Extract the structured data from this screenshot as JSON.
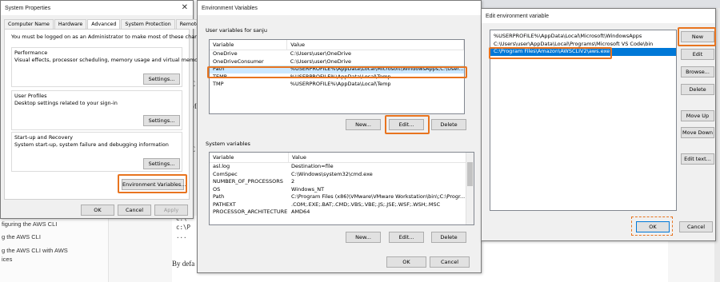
{
  "background_page": {
    "sidebar_links": [
      "figuring the AWS CLI",
      "g the AWS CLI",
      "g the AWS CLI with AWS",
      "ices"
    ],
    "code_lines": [
      "C:\\",
      "c:\\P",
      "..."
    ],
    "body_text": "By defa",
    "side_letters": [
      "C",
      "M",
      "t",
      "C"
    ]
  },
  "system_properties": {
    "title": "System Properties",
    "tabs": [
      "Computer Name",
      "Hardware",
      "Advanced",
      "System Protection",
      "Remote"
    ],
    "active_tab": "Advanced",
    "admin_note": "You must be logged on as an Administrator to make most of these changes.",
    "performance": {
      "title": "Performance",
      "desc": "Visual effects, processor scheduling, memory usage and virtual memory",
      "button": "Settings..."
    },
    "user_profiles": {
      "title": "User Profiles",
      "desc": "Desktop settings related to your sign-in",
      "button": "Settings..."
    },
    "startup": {
      "title": "Start-up and Recovery",
      "desc": "System start-up, system failure and debugging information",
      "button": "Settings..."
    },
    "env_button": "Environment Variables...",
    "ok": "OK",
    "cancel": "Cancel",
    "apply": "Apply"
  },
  "env_vars": {
    "title": "Environment Variables",
    "user_group_label": "User variables for sanju",
    "columns": [
      "Variable",
      "Value"
    ],
    "user_vars": [
      {
        "name": "OneDrive",
        "value": "C:\\Users\\user\\OneDrive"
      },
      {
        "name": "OneDriveConsumer",
        "value": "C:\\Users\\user\\OneDrive"
      },
      {
        "name": "Path",
        "value": "%USERPROFILE%\\AppData\\Local\\Microsoft\\WindowsApps;C:\\User..."
      },
      {
        "name": "TEMP",
        "value": "%USERPROFILE%\\AppData\\Local\\Temp"
      },
      {
        "name": "TMP",
        "value": "%USERPROFILE%\\AppData\\Local\\Temp"
      }
    ],
    "user_buttons": {
      "new": "New...",
      "edit": "Edit...",
      "delete": "Delete"
    },
    "system_group_label": "System variables",
    "system_vars": [
      {
        "name": "asl.log",
        "value": "Destination=file"
      },
      {
        "name": "ComSpec",
        "value": "C:\\Windows\\system32\\cmd.exe"
      },
      {
        "name": "NUMBER_OF_PROCESSORS",
        "value": "2"
      },
      {
        "name": "OS",
        "value": "Windows_NT"
      },
      {
        "name": "Path",
        "value": "C:\\Program Files (x86)\\VMware\\VMware Workstation\\bin\\;C:\\Progr..."
      },
      {
        "name": "PATHEXT",
        "value": ".COM;.EXE;.BAT;.CMD;.VBS;.VBE;.JS;.JSE;.WSF;.WSH;.MSC"
      },
      {
        "name": "PROCESSOR_ARCHITECTURE",
        "value": "AMD64"
      }
    ],
    "system_buttons": {
      "new": "New...",
      "edit": "Edit...",
      "delete": "Delete"
    },
    "ok": "OK",
    "cancel": "Cancel"
  },
  "edit_env": {
    "title": "Edit environment variable",
    "entries": [
      "%USERPROFILE%\\AppData\\Local\\Microsoft\\WindowsApps",
      "C:\\Users\\user\\AppData\\Local\\Programs\\Microsoft VS Code\\bin",
      "C:\\Program Files\\Amazon\\AWSCLIV2\\aws.exe"
    ],
    "buttons": {
      "new": "New",
      "edit": "Edit",
      "browse": "Browse...",
      "delete": "Delete",
      "move_up": "Move Up",
      "move_down": "Move Down",
      "edit_text": "Edit text..."
    },
    "ok": "OK",
    "cancel": "Cancel"
  },
  "colors": {
    "highlight": "#e8741f",
    "selection": "#0078d7"
  }
}
